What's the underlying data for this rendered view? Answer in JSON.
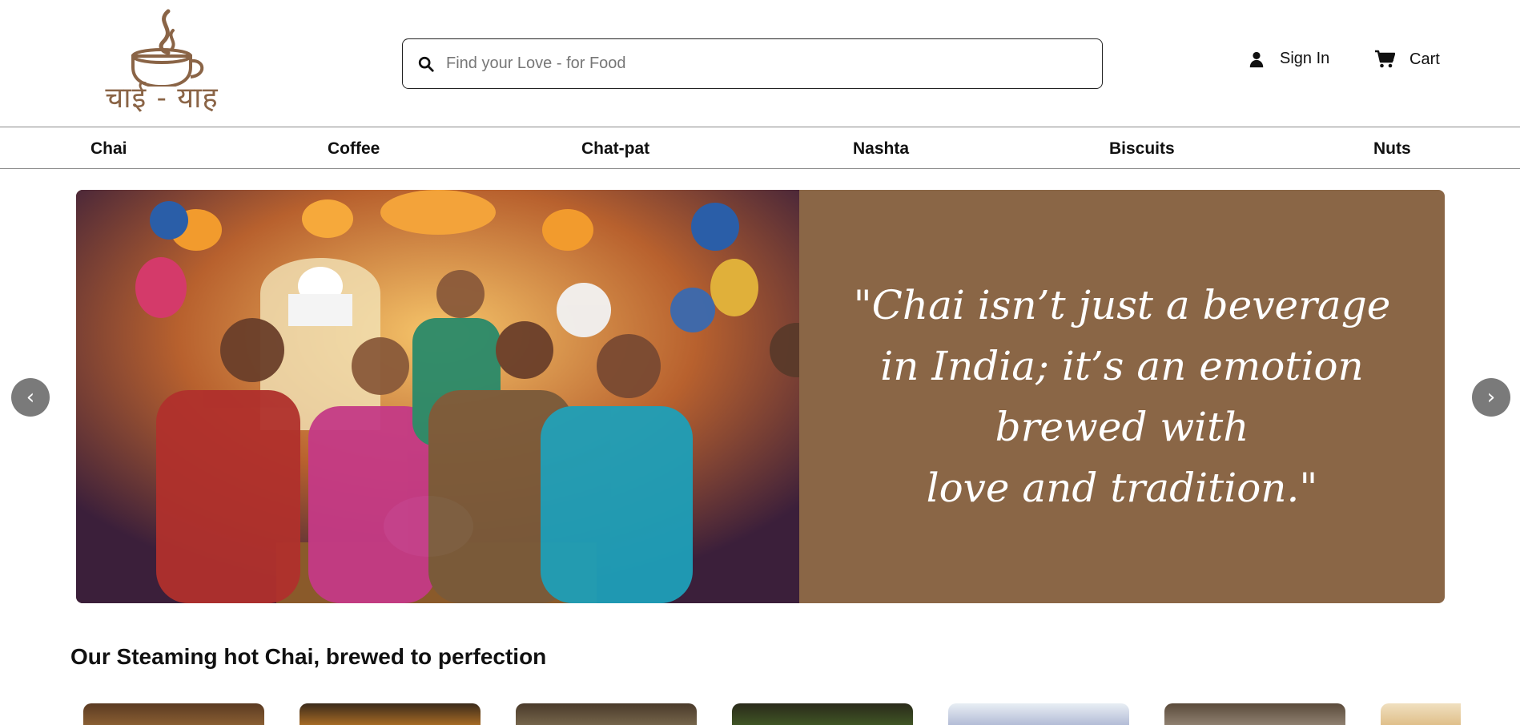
{
  "brand": {
    "logo_text": "चाई - याह"
  },
  "search": {
    "placeholder": "Find your Love - for Food",
    "value": ""
  },
  "header": {
    "signin_label": "Sign In",
    "cart_label": "Cart"
  },
  "categories": [
    "Chai",
    "Coffee",
    "Chat-pat",
    "Nashta",
    "Biscuits",
    "Nuts"
  ],
  "carousel": {
    "quote_lines": [
      "\"Chai isn’t just a beverage",
      "in India; it’s an emotion",
      "brewed with",
      "love and tradition.\""
    ],
    "prev_label": "‹",
    "next_label": "›",
    "panel_color": "#8a6646"
  },
  "section": {
    "title": "Our Steaming hot Chai, brewed to perfection"
  },
  "icons": {
    "search": "search-icon",
    "user": "user-icon",
    "cart": "cart-icon"
  }
}
